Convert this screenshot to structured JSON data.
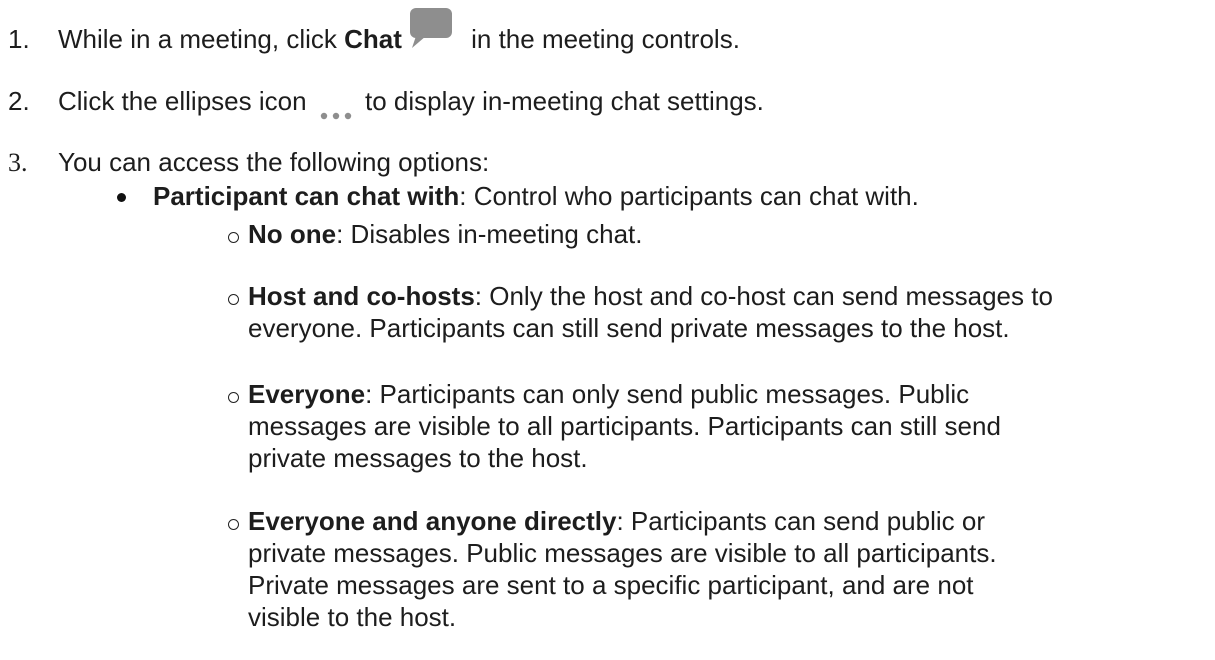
{
  "steps": [
    {
      "number": "1.",
      "pre": "While in a meeting, click ",
      "bold": "Chat",
      "icon": "chat-bubble-icon",
      "post": " in the meeting controls."
    },
    {
      "number": "2.",
      "pre": "Click the ellipses icon ",
      "icon": "ellipses-icon",
      "post": " to display in-meeting chat settings."
    },
    {
      "number": "3.",
      "text": "You can access the following options:"
    }
  ],
  "bullet": {
    "bold": "Participant can chat with",
    "text": ": Control who participants can chat with."
  },
  "options": [
    {
      "bold": "No one",
      "lines": [
        ": Disables in-meeting chat."
      ]
    },
    {
      "bold": "Host and co-hosts",
      "lines": [
        ": Only the host and co-host can send messages to",
        "everyone. Participants can still send private messages to the host."
      ]
    },
    {
      "bold": "Everyone",
      "lines": [
        ": Participants can only send public messages. Public",
        "messages are visible to all participants. Participants can still send",
        "private messages to the host."
      ]
    },
    {
      "bold": "Everyone and anyone directly",
      "lines": [
        ": Participants can send public or",
        "private messages. Public messages are visible to all participants.",
        "Private messages are sent to a specific participant, and are not",
        "visible to the host."
      ]
    }
  ],
  "colors": {
    "text": "#1d1d1d",
    "icon_gray": "#8e8e8e"
  }
}
